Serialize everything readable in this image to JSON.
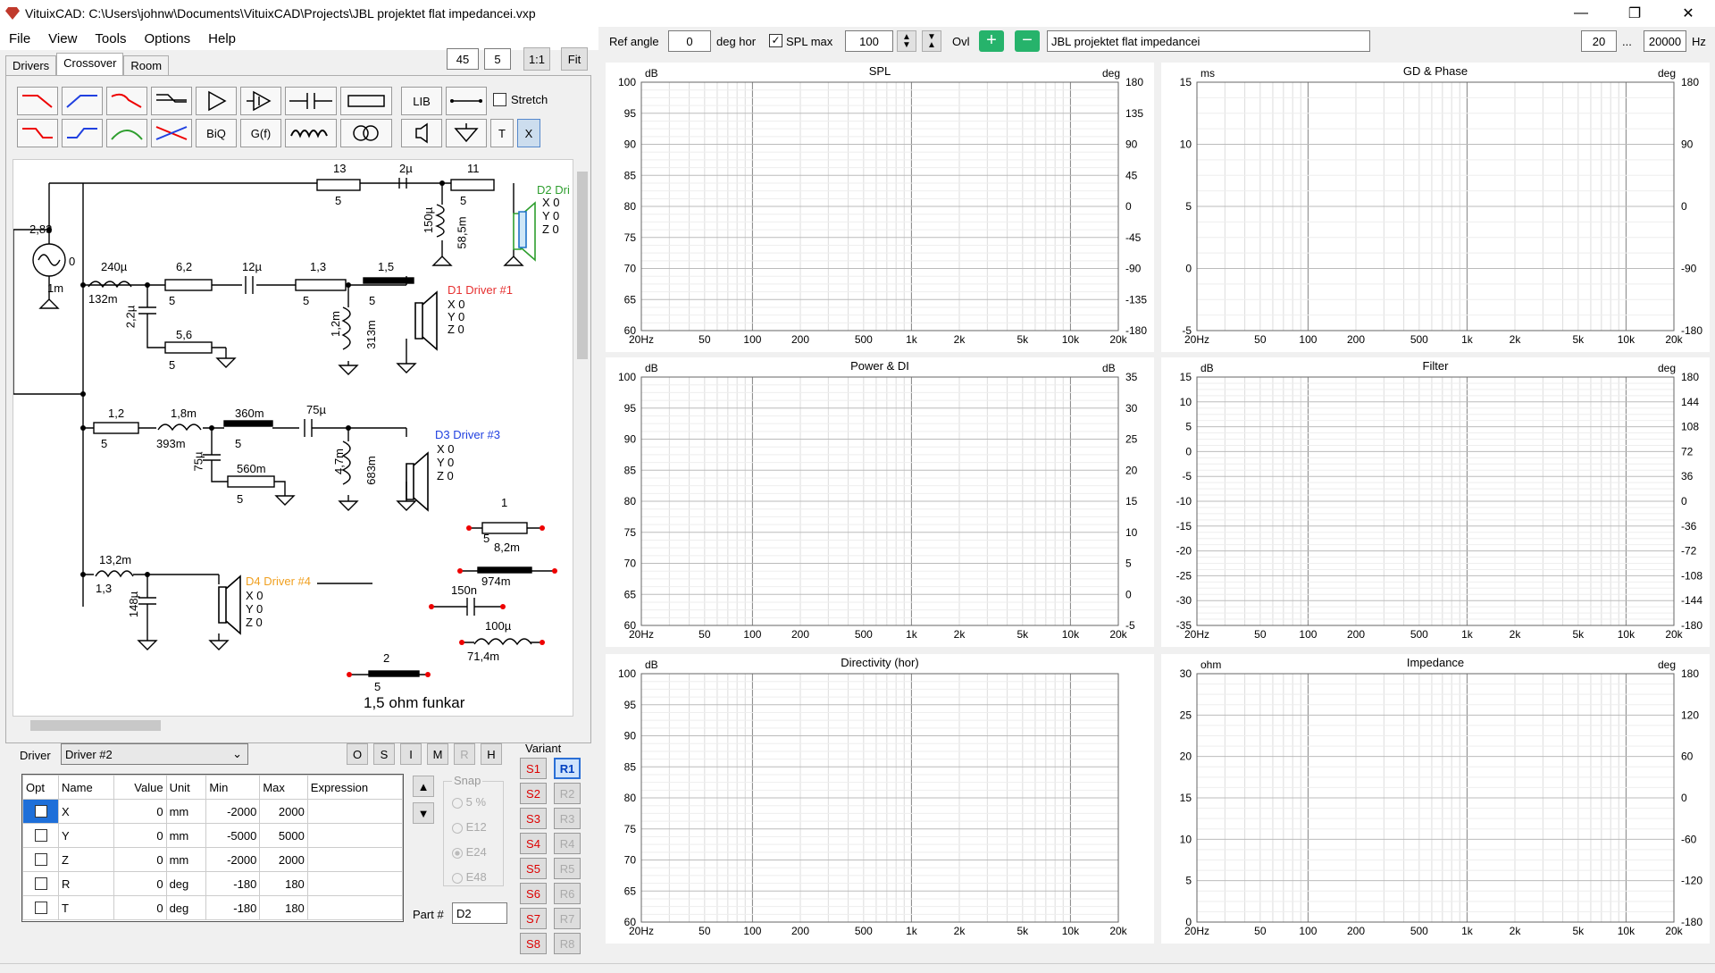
{
  "window": {
    "title": "VituixCAD: C:\\Users\\johnw\\Documents\\VituixCAD\\Projects\\JBL projektet flat impedancei.vxp",
    "minimize": "—",
    "maximize": "❐",
    "close": "✕"
  },
  "menu": [
    "File",
    "View",
    "Tools",
    "Options",
    "Help"
  ],
  "zoom": {
    "a": "45",
    "b": "5",
    "one": "1:1",
    "fit": "Fit"
  },
  "tabs": [
    "Drivers",
    "Crossover",
    "Room"
  ],
  "toolbar_text": {
    "lib": "LIB",
    "stretch": "Stretch",
    "biq": "BiQ",
    "gf": "G(f)",
    "t": "T",
    "x": "X"
  },
  "top": {
    "ref_angle_label": "Ref angle",
    "ref_angle": "0",
    "deg_hor": "deg hor",
    "spl_max_label": "SPL max",
    "spl_max": "100",
    "ovl": "Ovl",
    "project_name": "JBL projektet flat impedancei",
    "f_min": "20",
    "f_sep": "...",
    "f_max": "20000",
    "hz": "Hz"
  },
  "schematic": {
    "source": {
      "v": "2,83",
      "r": "0",
      "l": "1m"
    },
    "d2": {
      "name": "D2 Dri",
      "x": "X 0",
      "y": "Y 0",
      "z": "Z 0",
      "r1": "13",
      "r1b": "5",
      "c1": "2µ",
      "r2": "11",
      "r2b": "5",
      "l1": "150µ",
      "l1b": "58,5m"
    },
    "d1": {
      "name": "D1 Driver #1",
      "x": "X 0",
      "y": "Y 0",
      "z": "Z 0",
      "l1": "240µ",
      "l1b": "132m",
      "c1": "2,2µ",
      "r1": "6,2",
      "r1b": "5",
      "c2": "12µ",
      "r2": "1,3",
      "r2b": "5",
      "r3": "1,5",
      "r3b": "5",
      "l2": "1,2m",
      "l2b": "313m",
      "r4": "5,6",
      "r4b": "5"
    },
    "d3": {
      "name": "D3 Driver #3",
      "x": "X 0",
      "y": "Y 0",
      "z": "Z 0",
      "r1": "1,2",
      "r1b": "5",
      "l1": "1,8m",
      "l1b": "393m",
      "r2": "360m",
      "r2b": "5",
      "c1": "75µ",
      "c2": "75µ",
      "r3": "560m",
      "r3b": "5",
      "l2": "4,7m",
      "l2b": "683m"
    },
    "d4": {
      "name": "D4 Driver #4",
      "x": "X 0",
      "y": "Y 0",
      "z": "Z 0",
      "l1": "13,2m",
      "l1b": "1,3",
      "c1": "148µ"
    },
    "loose": {
      "r1": "1",
      "r1b": "5",
      "r2": "8,2m",
      "r2b": "974m",
      "c": "150n",
      "l": "100µ",
      "lb": "71,4m",
      "r3": "2",
      "r3b": "5"
    },
    "note": "1,5 ohm funkar"
  },
  "driver_panel": {
    "label": "Driver",
    "selected": "Driver #2",
    "buttons": [
      "O",
      "S",
      "I",
      "M",
      "R",
      "H"
    ],
    "variant_label": "Variant"
  },
  "param_table": {
    "headers": [
      "Opt",
      "Name",
      "Value",
      "Unit",
      "Min",
      "Max",
      "Expression"
    ],
    "rows": [
      [
        "X",
        "0",
        "mm",
        "-2000",
        "2000"
      ],
      [
        "Y",
        "0",
        "mm",
        "-5000",
        "5000"
      ],
      [
        "Z",
        "0",
        "mm",
        "-2000",
        "2000"
      ],
      [
        "R",
        "0",
        "deg",
        "-180",
        "180"
      ],
      [
        "T",
        "0",
        "deg",
        "-180",
        "180"
      ]
    ]
  },
  "snap": {
    "label": "Snap",
    "options": [
      "5 %",
      "E12",
      "E24",
      "E48"
    ]
  },
  "part": {
    "label": "Part #",
    "value": "D2"
  },
  "variants": {
    "s": [
      "S1",
      "S2",
      "S3",
      "S4",
      "S5",
      "S6",
      "S7",
      "S8"
    ],
    "r": [
      "R1",
      "R2",
      "R3",
      "R4",
      "R5",
      "R6",
      "R7",
      "R8"
    ]
  },
  "freq_ticks": [
    "20Hz",
    "50",
    "100",
    "200",
    "500",
    "1k",
    "2k",
    "5k",
    "10k",
    "20k"
  ],
  "charts": {
    "spl": {
      "title": "SPL",
      "left_unit": "dB",
      "right_unit": "deg",
      "left": [
        "100",
        "95",
        "90",
        "85",
        "80",
        "75",
        "70",
        "65",
        "60"
      ],
      "right": [
        "180",
        "135",
        "90",
        "45",
        "0",
        "-45",
        "-90",
        "-135",
        "-180"
      ]
    },
    "gd": {
      "title": "GD & Phase",
      "left_unit": "ms",
      "right_unit": "deg",
      "left": [
        "15",
        "10",
        "5",
        "0",
        "-5"
      ],
      "right": [
        "180",
        "90",
        "0",
        "-90",
        "-180"
      ]
    },
    "power": {
      "title": "Power & DI",
      "left_unit": "dB",
      "right_unit": "dB",
      "left": [
        "100",
        "95",
        "90",
        "85",
        "80",
        "75",
        "70",
        "65",
        "60"
      ],
      "right": [
        "35",
        "30",
        "25",
        "20",
        "15",
        "10",
        "5",
        "0",
        "-5"
      ]
    },
    "filter": {
      "title": "Filter",
      "left_unit": "dB",
      "right_unit": "deg",
      "left": [
        "15",
        "10",
        "5",
        "0",
        "-5",
        "-10",
        "-15",
        "-20",
        "-25",
        "-30",
        "-35"
      ],
      "right": [
        "180",
        "144",
        "108",
        "72",
        "36",
        "0",
        "-36",
        "-72",
        "-108",
        "-144",
        "-180"
      ]
    },
    "directivity": {
      "title": "Directivity (hor)",
      "left_unit": "dB",
      "left": [
        "100",
        "95",
        "90",
        "85",
        "80",
        "75",
        "70",
        "65",
        "60"
      ]
    },
    "impedance": {
      "title": "Impedance",
      "left_unit": "ohm",
      "right_unit": "deg",
      "left": [
        "30",
        "25",
        "20",
        "15",
        "10",
        "5",
        "0"
      ],
      "right": [
        "180",
        "120",
        "60",
        "0",
        "-60",
        "-120",
        "-180"
      ]
    }
  },
  "colors": {
    "d1": "#e63030",
    "d2": "#2e9e2e",
    "d3": "#2040e0",
    "d4": "#f0a020",
    "sum": "#101060",
    "target": "#cc33cc"
  }
}
